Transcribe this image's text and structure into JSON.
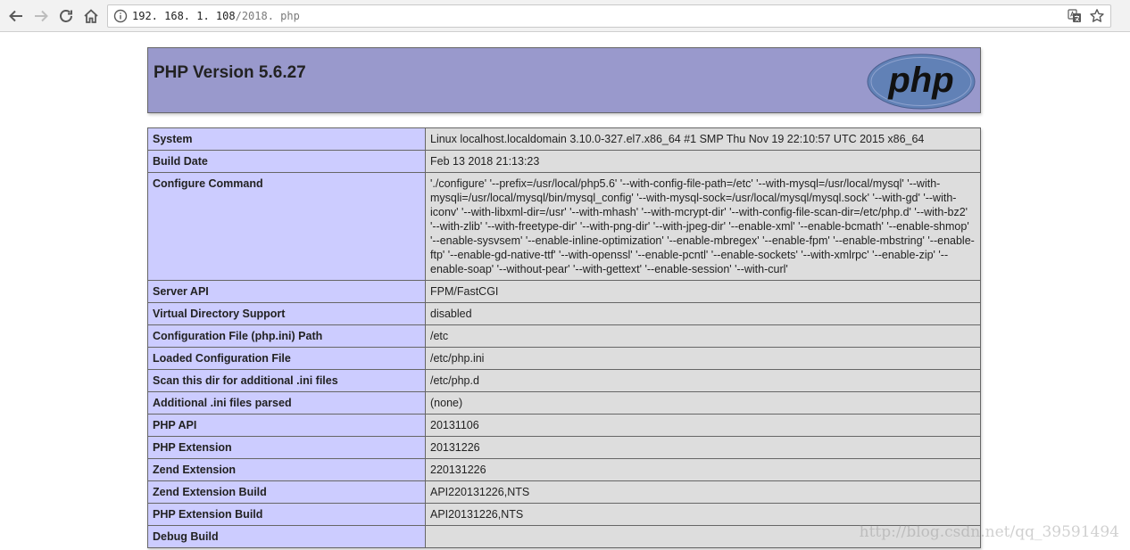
{
  "browser": {
    "url_host": "192. 168. 1. 108",
    "url_path": "/2018. php"
  },
  "phpinfo": {
    "title": "PHP Version 5.6.27",
    "logo_text": "php",
    "rows": [
      {
        "key": "System",
        "value": "Linux localhost.localdomain 3.10.0-327.el7.x86_64 #1 SMP Thu Nov 19 22:10:57 UTC 2015 x86_64"
      },
      {
        "key": "Build Date",
        "value": "Feb 13 2018 21:13:23"
      },
      {
        "key": "Configure Command",
        "value": "'./configure' '--prefix=/usr/local/php5.6' '--with-config-file-path=/etc' '--with-mysql=/usr/local/mysql' '--with-mysqli=/usr/local/mysql/bin/mysql_config' '--with-mysql-sock=/usr/local/mysql/mysql.sock' '--with-gd' '--with-iconv' '--with-libxml-dir=/usr' '--with-mhash' '--with-mcrypt-dir' '--with-config-file-scan-dir=/etc/php.d' '--with-bz2' '--with-zlib' '--with-freetype-dir' '--with-png-dir' '--with-jpeg-dir' '--enable-xml' '--enable-bcmath' '--enable-shmop' '--enable-sysvsem' '--enable-inline-optimization' '--enable-mbregex' '--enable-fpm' '--enable-mbstring' '--enable-ftp' '--enable-gd-native-ttf' '--with-openssl' '--enable-pcntl' '--enable-sockets' '--with-xmlrpc' '--enable-zip' '--enable-soap' '--without-pear' '--with-gettext' '--enable-session' '--with-curl'"
      },
      {
        "key": "Server API",
        "value": "FPM/FastCGI"
      },
      {
        "key": "Virtual Directory Support",
        "value": "disabled"
      },
      {
        "key": "Configuration File (php.ini) Path",
        "value": "/etc"
      },
      {
        "key": "Loaded Configuration File",
        "value": "/etc/php.ini"
      },
      {
        "key": "Scan this dir for additional .ini files",
        "value": "/etc/php.d"
      },
      {
        "key": "Additional .ini files parsed",
        "value": "(none)"
      },
      {
        "key": "PHP API",
        "value": "20131106"
      },
      {
        "key": "PHP Extension",
        "value": "20131226"
      },
      {
        "key": "Zend Extension",
        "value": "220131226"
      },
      {
        "key": "Zend Extension Build",
        "value": "API220131226,NTS"
      },
      {
        "key": "PHP Extension Build",
        "value": "API20131226,NTS"
      },
      {
        "key": "Debug Build",
        "value": ""
      }
    ]
  },
  "watermark": "http://blog.csdn.net/qq_39591494",
  "colors": {
    "header_bg": "#9999cc",
    "key_bg": "#ccccff",
    "value_bg": "#dddddd",
    "logo_bg": "#6181b6"
  }
}
